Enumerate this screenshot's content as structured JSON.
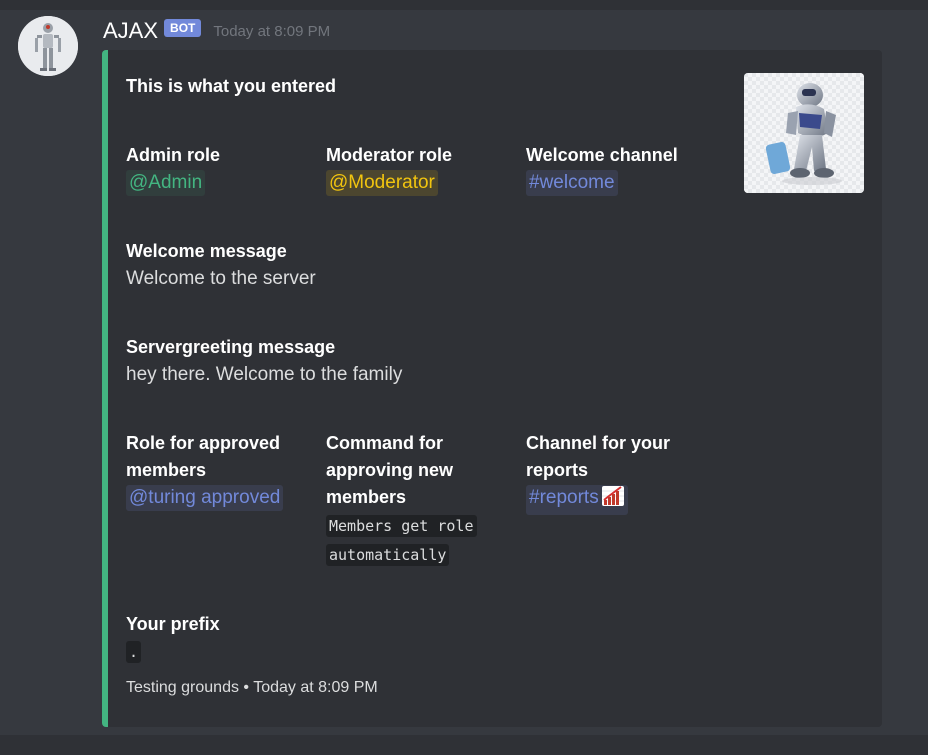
{
  "message": {
    "username": "AJAX",
    "bot_tag": "BOT",
    "timestamp": "Today at 8:09 PM"
  },
  "embed": {
    "accent_color": "#43b581",
    "title": "This is what you entered",
    "fields": {
      "admin_role": {
        "name": "Admin role",
        "value": "@Admin"
      },
      "moderator_role": {
        "name": "Moderator role",
        "value": "@Moderator"
      },
      "welcome_channel": {
        "name": "Welcome channel",
        "value": "#welcome"
      },
      "welcome_message": {
        "name": "Welcome message",
        "value": "Welcome to the server"
      },
      "servergreeting_message": {
        "name": "Servergreeting message",
        "value": "hey there. Welcome to the family"
      },
      "approved_role": {
        "name": "Role for approved members",
        "value": "@turing approved"
      },
      "approve_command": {
        "name": "Command for approving new members",
        "value": "Members get role automatically"
      },
      "reports_channel": {
        "name": "Channel for your reports",
        "value": "#reports"
      },
      "prefix": {
        "name": "Your prefix",
        "value": "."
      }
    },
    "footer": {
      "text": "Testing grounds",
      "separator": "•",
      "timestamp": "Today at 8:09 PM"
    },
    "icons": {
      "avatar": "robot-avatar",
      "thumbnail": "robot-thumbnail",
      "reports_emoji": "chart-increasing-icon"
    }
  }
}
